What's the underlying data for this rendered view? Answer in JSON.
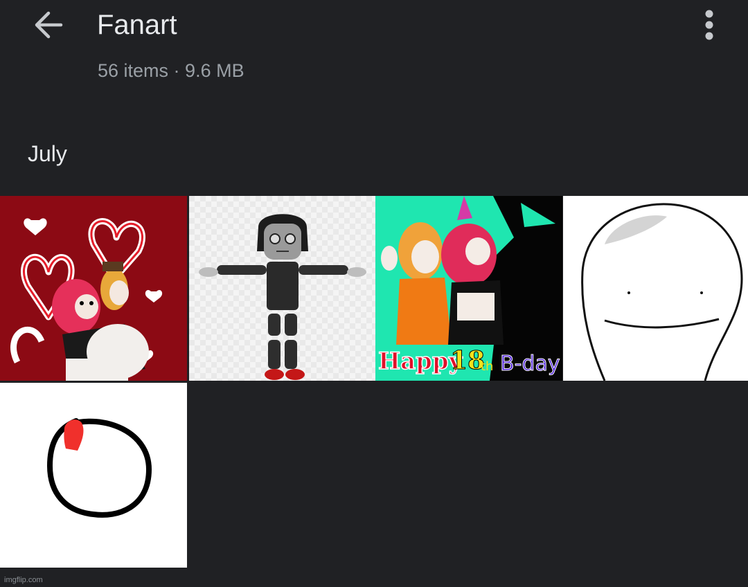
{
  "header": {
    "title": "Fanart",
    "back_icon": "arrow-back-icon",
    "more_icon": "more-vert-icon"
  },
  "album": {
    "item_count": "56 items",
    "separator": " · ",
    "size": "9.6 MB"
  },
  "section": {
    "label": "July"
  },
  "thumbnails": [
    {
      "description_icon": "fanart-hug-hearts-image"
    },
    {
      "description_icon": "fanart-tpose-character-image"
    },
    {
      "description_icon": "fanart-birthday-image",
      "caption_parts": [
        "Happy",
        "18",
        "th",
        "B-day!"
      ]
    },
    {
      "description_icon": "fanart-smiling-face-image"
    },
    {
      "description_icon": "fanart-circle-doodle-image"
    }
  ],
  "watermark": "imgflip.com",
  "colors": {
    "background": "#202124",
    "title": "#e8eaed",
    "subtitle": "#9aa0a6"
  }
}
